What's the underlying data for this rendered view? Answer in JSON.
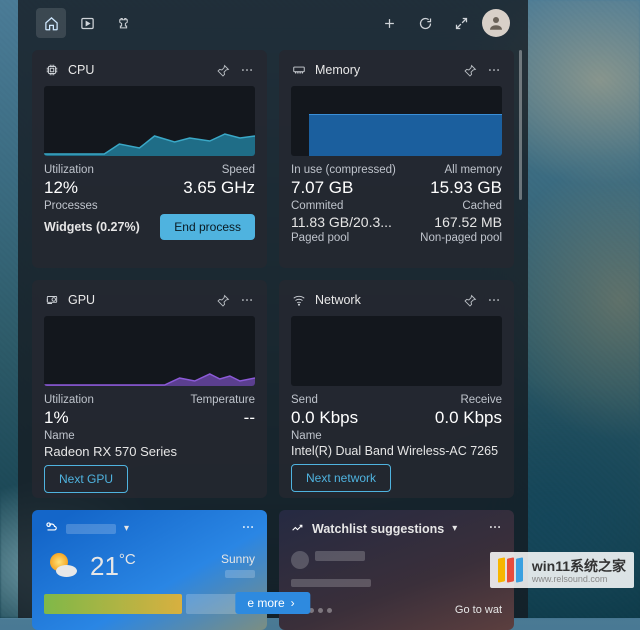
{
  "cpu": {
    "title": "CPU",
    "util_label": "Utilization",
    "util_value": "12%",
    "speed_label": "Speed",
    "speed_value": "3.65 GHz",
    "proc_label": "Processes",
    "proc_value": "Widgets (0.27%)",
    "button": "End process"
  },
  "memory": {
    "title": "Memory",
    "inuse_label": "In use (compressed)",
    "inuse_value": "7.07 GB",
    "all_label": "All memory",
    "all_value": "15.93 GB",
    "commit_label": "Commited",
    "commit_value": "11.83 GB/20.3...",
    "cached_label": "Cached",
    "cached_value": "167.52 MB",
    "paged_label": "Paged pool",
    "nonpaged_label": "Non-paged pool"
  },
  "gpu": {
    "title": "GPU",
    "util_label": "Utilization",
    "util_value": "1%",
    "temp_label": "Temperature",
    "temp_value": "--",
    "name_label": "Name",
    "name_value": "Radeon RX 570 Series",
    "button": "Next GPU"
  },
  "network": {
    "title": "Network",
    "send_label": "Send",
    "send_value": "0.0 Kbps",
    "recv_label": "Receive",
    "recv_value": "0.0 Kbps",
    "name_label": "Name",
    "name_value": "Intel(R) Dual Band Wireless-AC 7265",
    "button": "Next network"
  },
  "weather": {
    "temp": "21",
    "unit": "°C",
    "cond": "Sunny"
  },
  "watchlist": {
    "title": "Watchlist suggestions",
    "goto": "Go to wat"
  },
  "more_button": "e more",
  "watermark": {
    "brand": "win11系统之家",
    "url": "www.relsound.com"
  }
}
